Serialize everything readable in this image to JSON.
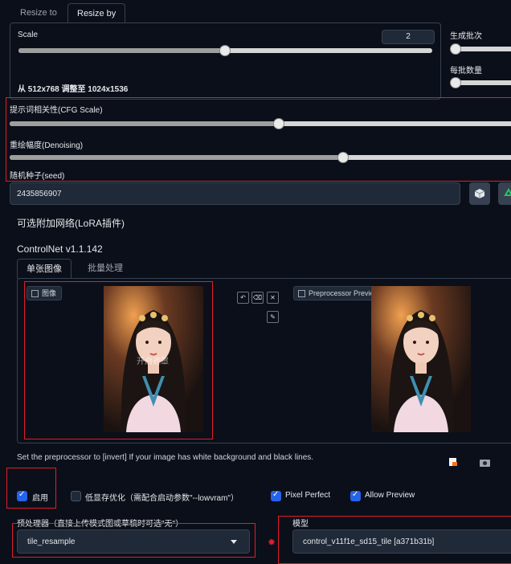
{
  "resize_tabs": [
    "Resize to",
    "Resize by"
  ],
  "scale": {
    "label": "Scale",
    "value": "2",
    "level": 0.5
  },
  "resize_info": "从 512x768 调整至 1024x1536",
  "batch": {
    "batch_count_label": "生成批次",
    "batch_size_label": "每批数量"
  },
  "cfg": {
    "label": "提示词相关性(CFG Scale)",
    "level": 0.5
  },
  "denoising": {
    "label": "重绘幅度(Denoising)",
    "level": 0.63
  },
  "seed": {
    "label": "随机种子(seed)",
    "value": "2435856907"
  },
  "lora_label": "可选附加网络(LoRA插件)",
  "controlnet": {
    "title": "ControlNet v1.1.142",
    "tabs": [
      "单张图像",
      "批量处理"
    ],
    "image_label": "图像",
    "overlay_text": "开启遮罩",
    "preview_label": "Preprocessor Preview",
    "hint": "Set the preprocessor to [invert] If your image has white background and black lines.",
    "checkboxes": [
      {
        "label": "启用",
        "checked": true
      },
      {
        "label": "低显存优化（需配合启动参数\"--lowvram\"）",
        "checked": false
      },
      {
        "label": "Pixel Perfect",
        "checked": true
      },
      {
        "label": "Allow Preview",
        "checked": true
      }
    ],
    "preprocessor": {
      "label": "预处理器（直接上传模式图或草稿时可选\"无\"）",
      "value": "tile_resample"
    },
    "model": {
      "label": "模型",
      "value": "control_v11f1e_sd15_tile [a371b31b]"
    }
  },
  "colors": {
    "accent": "#2563eb",
    "highlight": "#e11d2a",
    "background": "#0b0f19"
  }
}
